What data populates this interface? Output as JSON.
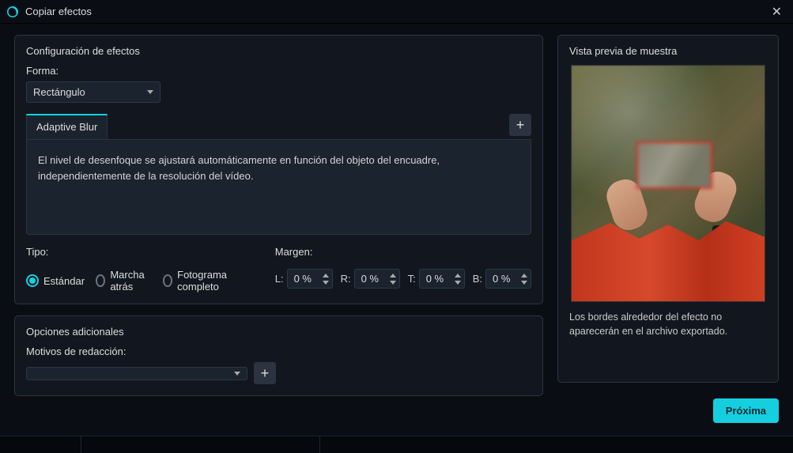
{
  "window": {
    "title": "Copiar efectos"
  },
  "effects_panel": {
    "title": "Configuración de efectos",
    "shape_label": "Forma:",
    "shape_value": "Rectángulo",
    "tab_label": "Adaptive Blur",
    "blur_description": "El nivel de desenfoque se ajustará automáticamente en función del objeto del encuadre, independientemente de la resolución del vídeo.",
    "tipo_label": "Tipo:",
    "radio_standard": "Estándar",
    "radio_reverse": "Marcha atrás",
    "radio_fullframe": "Fotograma completo",
    "margin_label": "Margen:",
    "margin_L_label": "L:",
    "margin_R_label": "R:",
    "margin_T_label": "T:",
    "margin_B_label": "B:",
    "margin_L": "0 %",
    "margin_R": "0 %",
    "margin_T": "0 %",
    "margin_B": "0 %"
  },
  "options_panel": {
    "title": "Opciones adicionales",
    "redaction_label": "Motivos de redacción:",
    "redaction_value": ""
  },
  "preview_panel": {
    "title": "Vista previa de muestra",
    "note": "Los bordes alrededor del efecto no aparecerán en el archivo exportado."
  },
  "footer": {
    "next": "Próxima"
  }
}
